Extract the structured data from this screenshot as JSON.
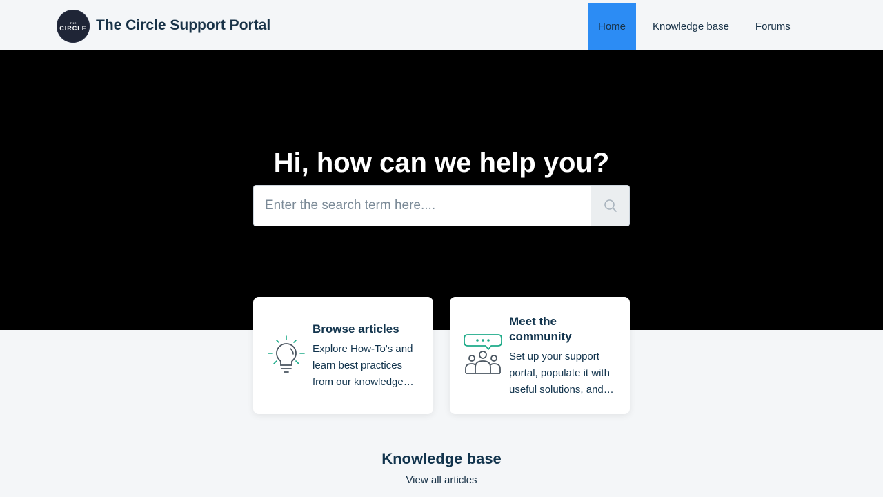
{
  "header": {
    "logo_small": "THE",
    "logo_big": "CIRCLE",
    "portal_title": "The Circle Support Portal",
    "nav": {
      "home": "Home",
      "knowledge_base": "Knowledge base",
      "forums": "Forums"
    },
    "active_nav": "Home"
  },
  "hero": {
    "title": "Hi, how can we help you?",
    "search": {
      "placeholder": "Enter the search term here....",
      "value": "",
      "button_icon": "search-icon"
    }
  },
  "cards": [
    {
      "icon": "lightbulb-icon",
      "title": "Browse articles",
      "description": "Explore How-To's and learn best practices from our knowledge base"
    },
    {
      "icon": "community-icon",
      "title": "Meet the community",
      "description": "Set up your support portal, populate it with useful solutions, and more"
    }
  ],
  "knowledge_base": {
    "title": "Knowledge base",
    "view_all": "View all articles"
  },
  "colors": {
    "accent": "#2c8cf4",
    "hero_bg": "#000000",
    "page_bg": "#f4f6f8",
    "icon_teal": "#1fab89",
    "text_dark": "#12344d"
  }
}
